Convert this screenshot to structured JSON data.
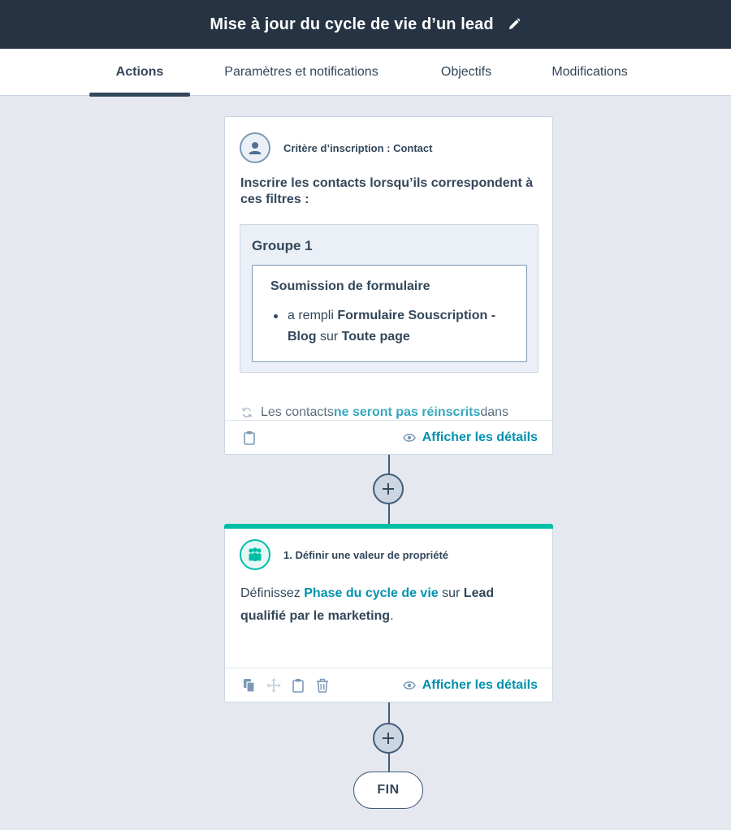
{
  "header": {
    "title": "Mise à jour du cycle de vie d’un lead"
  },
  "tabs": [
    {
      "label": "Actions",
      "active": true
    },
    {
      "label": "Paramètres et notifications",
      "active": false
    },
    {
      "label": "Objectifs",
      "active": false
    },
    {
      "label": "Modifications",
      "active": false
    }
  ],
  "enrollment": {
    "header_label": "Critère d’inscription : Contact",
    "intro": "Inscrire les contacts lorsqu’ils correspondent à ces filtres :",
    "group_title": "Groupe 1",
    "filter": {
      "title": "Soumission de formulaire",
      "prefix": "a rempli ",
      "form_name": "Formulaire Souscription - Blog",
      "middle": " sur ",
      "page": "Toute page"
    },
    "reenroll": {
      "prefix": "Les contacts ",
      "emphasis": "ne seront pas réinscrits",
      "suffix": " dans"
    },
    "details_label": "Afficher les détails"
  },
  "action1": {
    "header_label": "1. Définir une valeur de propriété",
    "accent_color": "#00bda5",
    "text_prefix": "Définissez ",
    "property": "Phase du cycle de vie",
    "text_middle": " sur ",
    "value": "Lead qualifié par le marketing",
    "text_suffix": ".",
    "details_label": "Afficher les détails"
  },
  "end": {
    "label": "FIN"
  },
  "colors": {
    "link": "#0091ae",
    "text": "#33475b",
    "header_bg": "#253342",
    "canvas": "#e5e8ef"
  }
}
